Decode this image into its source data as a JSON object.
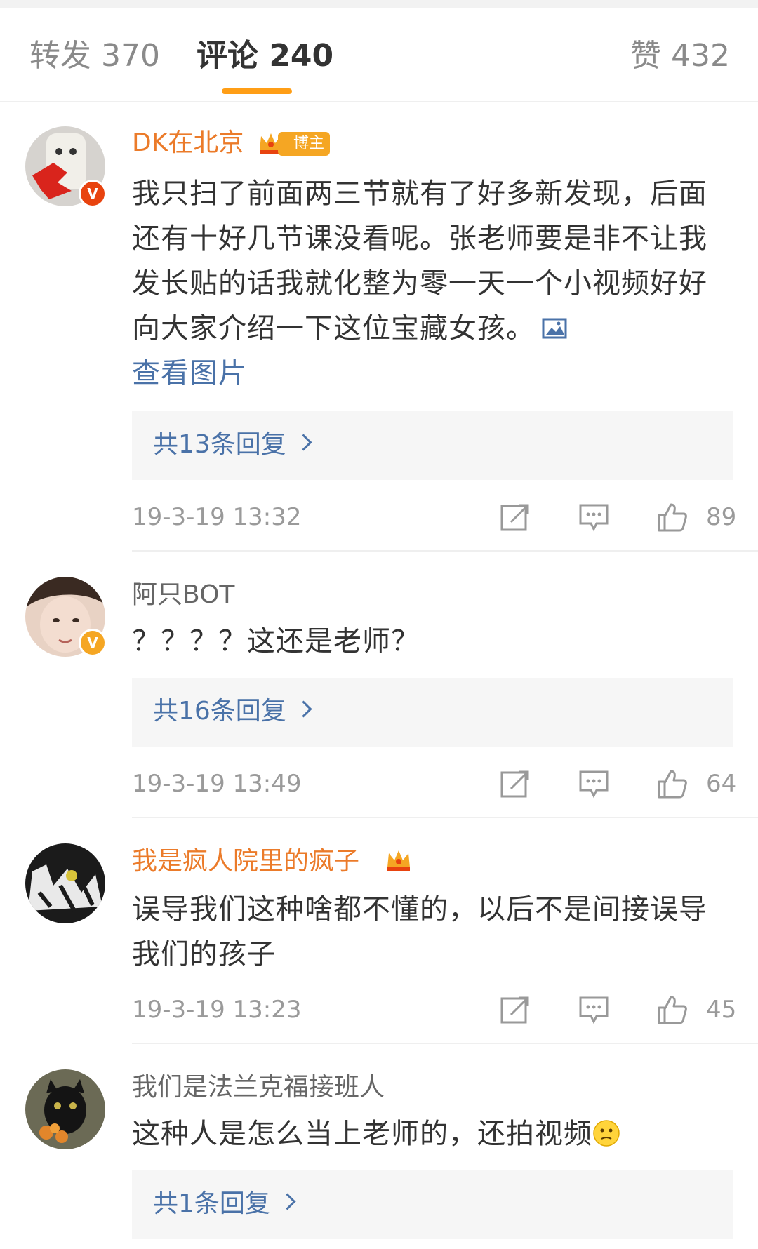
{
  "tabs": {
    "reposts": "转发 370",
    "comments": "评论 240",
    "likes": "赞 432"
  },
  "colors": {
    "accent": "#ff9e16",
    "link": "#4a72a8",
    "vip_name": "#eb7b2a"
  },
  "comments": [
    {
      "username": "DK在北京",
      "badge": "博主",
      "text": "我只扫了前面两三节就有了好多新发现，后面还有十好几节课没看呢。张老师要是非不让我发长贴的话我就化整为零一天一个小视频好好向大家介绍一下这位宝藏女孩。",
      "view_image": "查看图片",
      "replies": "共13条回复",
      "timestamp": "19-3-19 13:32",
      "likes": "89"
    },
    {
      "username": "阿只BOT",
      "text": "？？？？这还是老师？",
      "replies": "共16条回复",
      "timestamp": "19-3-19 13:49",
      "likes": "64"
    },
    {
      "username": "我是疯人院里的疯子",
      "text": "误导我们这种啥都不懂的，以后不是间接误导我们的孩子",
      "timestamp": "19-3-19 13:23",
      "likes": "45"
    },
    {
      "username": "我们是法兰克福接班人",
      "text": "这种人是怎么当上老师的，还拍视频",
      "replies": "共1条回复"
    }
  ]
}
